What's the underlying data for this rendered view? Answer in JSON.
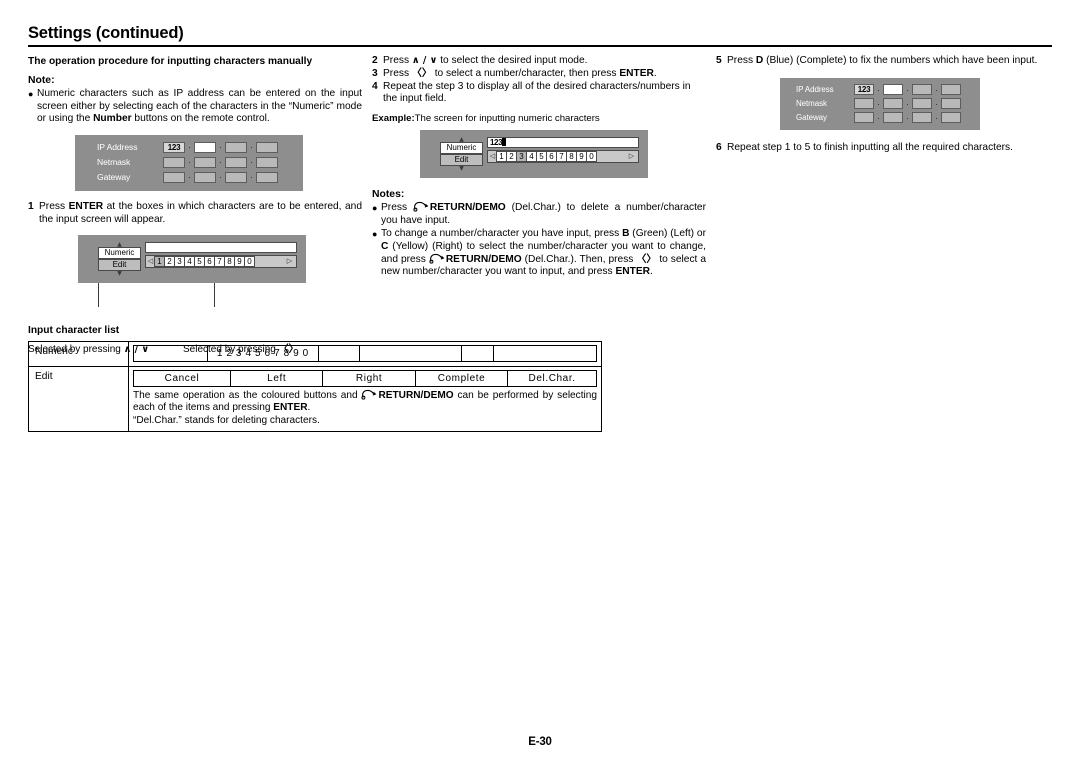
{
  "header": {
    "title": "Settings (continued)"
  },
  "left": {
    "section_heading": "The operation procedure for inputting characters manually",
    "note_heading": "Note:",
    "note_text_1": "Numeric characters such as IP address can be entered on the input screen either by selecting each of the characters in the “Numeric” mode or using the ",
    "note_bold_number": "Number",
    "note_text_2": " buttons on the remote control.",
    "step1_num": "1",
    "step1_a": "Press ",
    "step1_bold": "ENTER",
    "step1_b": " at the boxes in which characters are to be entered, and the input screen will appear.",
    "caption_updown": "Selected by pressing ",
    "caption_updown_glyph": "∧ / ∨",
    "caption_leftright": "Selected by pressing ",
    "caption_leftright_glyph": "〈〉"
  },
  "osd_ip": {
    "rows": [
      {
        "label": "IP Address",
        "boxes": [
          "123",
          "",
          "",
          ""
        ],
        "types": [
          "val",
          "white",
          "grey",
          "grey"
        ]
      },
      {
        "label": "Netmask",
        "boxes": [
          "",
          "",
          "",
          ""
        ],
        "types": [
          "grey",
          "grey",
          "grey",
          "grey"
        ]
      },
      {
        "label": "Gateway",
        "boxes": [
          "",
          "",
          "",
          ""
        ],
        "types": [
          "grey",
          "grey",
          "grey",
          "grey"
        ]
      }
    ],
    "separator": "·"
  },
  "osd_input_left": {
    "mode_up": "▲",
    "mode_down": "▼",
    "mode_numeric": "Numeric",
    "mode_edit": "Edit",
    "field_value": "",
    "selected_mode": "Numeric",
    "left_chevron": "◁",
    "right_chevron": "▷",
    "keys": [
      "1",
      "2",
      "3",
      "4",
      "5",
      "6",
      "7",
      "8",
      "9",
      "0"
    ],
    "highlighted_key": "1"
  },
  "osd_input_mid": {
    "mode_up": "▲",
    "mode_down": "▼",
    "mode_numeric": "Numeric",
    "mode_edit": "Edit",
    "field_value": "123",
    "selected_mode": "Edit",
    "left_chevron": "◁",
    "right_chevron": "▷",
    "keys": [
      "1",
      "2",
      "3",
      "4",
      "5",
      "6",
      "7",
      "8",
      "9",
      "0"
    ],
    "highlighted_key": "3"
  },
  "middle": {
    "step2_num": "2",
    "step2_a": "Press ",
    "step2_glyph": "∧ / ∨",
    "step2_b": " to select the desired input mode.",
    "step3_num": "3",
    "step3_a": "Press ",
    "step3_glyph": "〈〉",
    "step3_b": " to select a number/character, then press ",
    "step3_bold": "ENTER",
    "step3_c": ".",
    "step4_num": "4",
    "step4_text": "Repeat the step 3 to display all of the desired characters/numbers in the input field.",
    "example_label": "Example:",
    "example_text": "The screen for inputting numeric characters",
    "notes_heading": "Notes:",
    "note1_a": "Press ",
    "note1_bold": "RETURN/DEMO",
    "note1_b": " (Del.Char.) to delete a number/character you have input.",
    "note2_a": "To change a number/character you have input, press ",
    "note2_b1": "B",
    "note2_c": " (Green) (Left) or ",
    "note2_b2": "C",
    "note2_d": " (Yellow) (Right) to select the number/character you want to change, and press ",
    "note2_bold2": "RETURN/DEMO",
    "note2_e": " (Del.Char.). Then, press ",
    "note2_glyph": "〈〉",
    "note2_f": " to select a new number/character you want to input, and press ",
    "note2_bold3": "ENTER",
    "note2_g": "."
  },
  "right": {
    "step5_num": "5",
    "step5_a": "Press ",
    "step5_bold": "D",
    "step5_b": " (Blue) (Complete) to fix the numbers which have been input.",
    "step6_num": "6",
    "step6_text": "Repeat step 1 to 5 to finish inputting all the required characters."
  },
  "input_character_list": {
    "title": "Input character list",
    "row_numeric_label": "Numeric",
    "row_numeric_cells": [
      "",
      "1 2 3 4 5 6 7 8 9 0",
      "",
      "",
      "",
      ""
    ],
    "row_edit_label": "Edit",
    "row_edit_cells": [
      "Cancel",
      "Left",
      "Right",
      "Complete",
      "Del.Char."
    ],
    "note_a": "The same operation as the coloured buttons and ",
    "note_bold": "RETURN/DEMO",
    "note_b": " can be performed by selecting each of the items and pressing ",
    "note_bold2": "ENTER",
    "note_c": ".",
    "note_line2": "“Del.Char.” stands for deleting characters."
  },
  "footer": {
    "page": "E-30"
  },
  "colors": {
    "osd_background": "#8e8e8e",
    "osd_box": "#b9b9b9",
    "osd_box_selected": "#ffffff",
    "charbar_background": "#c9c9c9",
    "text": "#000000"
  }
}
